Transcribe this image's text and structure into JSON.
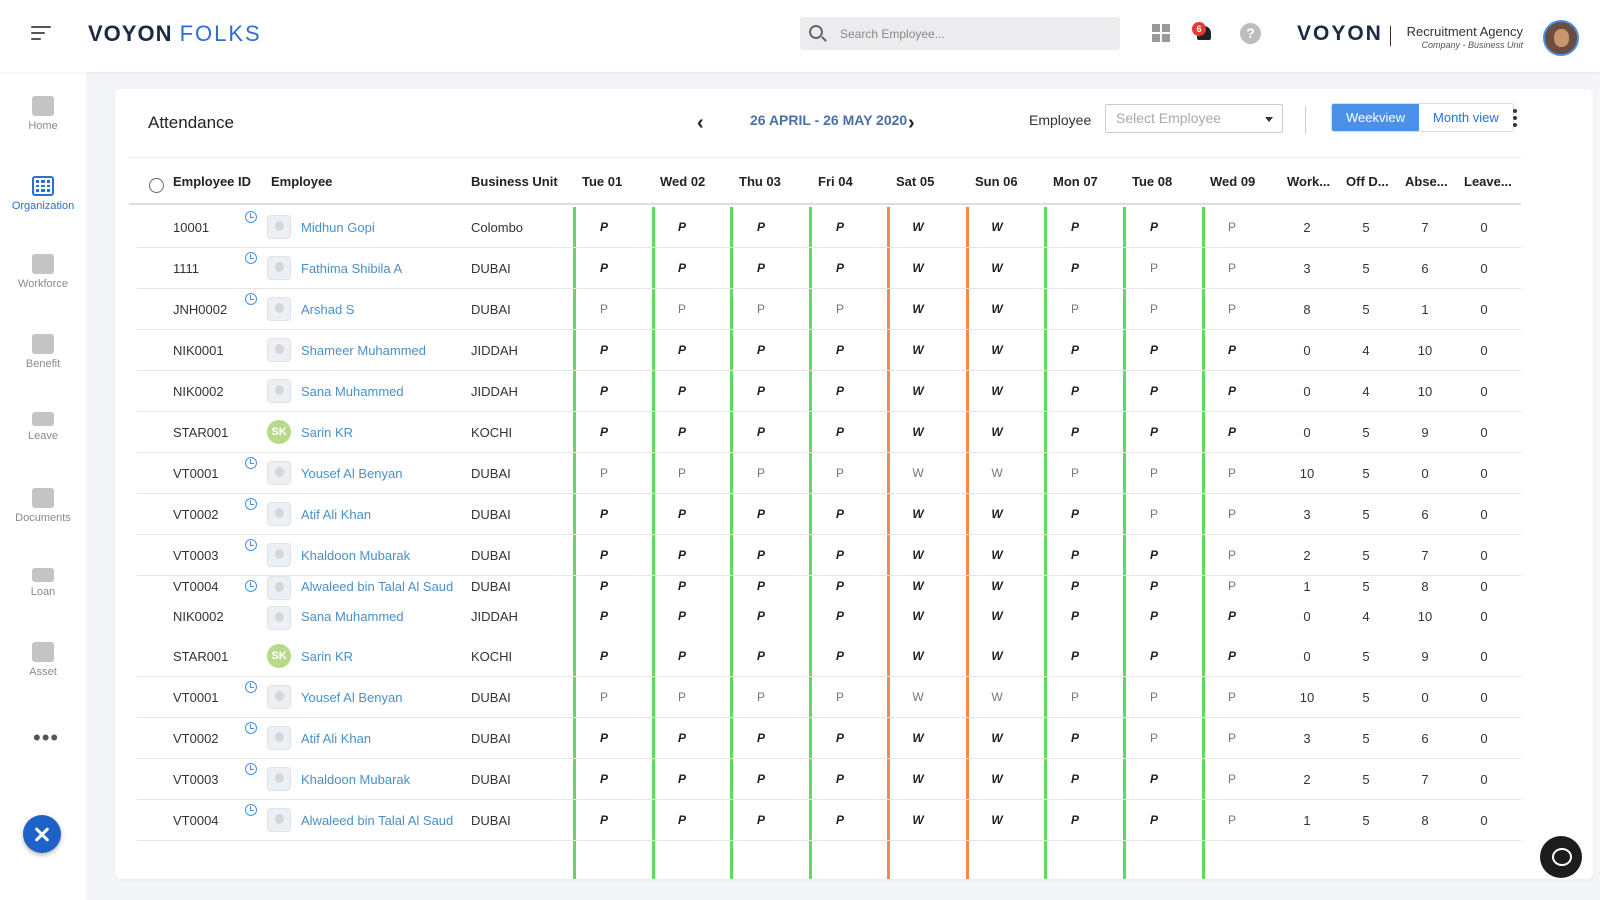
{
  "header": {
    "logo_main": "VOYON",
    "logo_sub": "FOLKS",
    "search_placeholder": "Search Employee...",
    "notification_count": "6",
    "help_glyph": "?",
    "brand": "VOYON",
    "company_name": "Recruitment Agency",
    "company_sub": "Company - Business Unit"
  },
  "sidebar": {
    "items": [
      {
        "label": "Home",
        "icon": "home-icon"
      },
      {
        "label": "Organization",
        "icon": "organization-icon"
      },
      {
        "label": "Workforce",
        "icon": "workforce-icon"
      },
      {
        "label": "Benefit",
        "icon": "benefit-icon"
      },
      {
        "label": "Leave",
        "icon": "leave-icon"
      },
      {
        "label": "Documents",
        "icon": "documents-icon"
      },
      {
        "label": "Loan",
        "icon": "loan-icon"
      },
      {
        "label": "Asset",
        "icon": "asset-icon"
      }
    ],
    "more": "•••"
  },
  "attendance": {
    "title": "Attendance",
    "date_range": "26 APRIL - 26 MAY 2020",
    "prev_glyph": "‹",
    "next_glyph": "›",
    "employee_label": "Employee",
    "employee_select_placeholder": "Select Employee",
    "view_week": "Weekview",
    "view_month": "Month view"
  },
  "table": {
    "columns": {
      "id": "Employee ID",
      "employee": "Employee",
      "unit": "Business Unit",
      "days": [
        "Tue 01",
        "Wed 02",
        "Thu 03",
        "Fri 04",
        "Sat 05",
        "Sun 06",
        "Mon 07",
        "Tue 08",
        "Wed 09"
      ],
      "stats": [
        "Work...",
        "Off D...",
        "Abse...",
        "Leave..."
      ]
    },
    "rows": [
      {
        "id": "10001",
        "name": "Midhun Gopi",
        "unit": "Colombo",
        "clock": true,
        "avatar": "photo",
        "marks": [
          "P",
          "P",
          "P",
          "P",
          "W",
          "W",
          "P",
          "P",
          "P"
        ],
        "bold": [
          1,
          1,
          1,
          1,
          1,
          1,
          1,
          1,
          0
        ],
        "stats": [
          "2",
          "5",
          "7",
          "0"
        ]
      },
      {
        "id": "1111",
        "name": "Fathima Shibila A",
        "unit": "DUBAI",
        "clock": true,
        "avatar": "photo",
        "marks": [
          "P",
          "P",
          "P",
          "P",
          "W",
          "W",
          "P",
          "P",
          "P"
        ],
        "bold": [
          1,
          1,
          1,
          1,
          1,
          1,
          1,
          0,
          0
        ],
        "stats": [
          "3",
          "5",
          "6",
          "0"
        ]
      },
      {
        "id": "JNH0002",
        "name": "Arshad S",
        "unit": "DUBAI",
        "clock": true,
        "avatar": "photo",
        "marks": [
          "P",
          "P",
          "P",
          "P",
          "W",
          "W",
          "P",
          "P",
          "P"
        ],
        "bold": [
          0,
          0,
          0,
          0,
          1,
          1,
          0,
          0,
          0
        ],
        "stats": [
          "8",
          "5",
          "1",
          "0"
        ]
      },
      {
        "id": "NIK0001",
        "name": "Shameer Muhammed",
        "unit": "JIDDAH",
        "clock": false,
        "avatar": "photo",
        "marks": [
          "P",
          "P",
          "P",
          "P",
          "W",
          "W",
          "P",
          "P",
          "P"
        ],
        "bold": [
          1,
          1,
          1,
          1,
          1,
          1,
          1,
          1,
          1
        ],
        "stats": [
          "0",
          "4",
          "10",
          "0"
        ]
      },
      {
        "id": "NIK0002",
        "name": "Sana Muhammed",
        "unit": "JIDDAH",
        "clock": false,
        "avatar": "photo",
        "marks": [
          "P",
          "P",
          "P",
          "P",
          "W",
          "W",
          "P",
          "P",
          "P"
        ],
        "bold": [
          1,
          1,
          1,
          1,
          1,
          1,
          1,
          1,
          1
        ],
        "stats": [
          "0",
          "4",
          "10",
          "0"
        ]
      },
      {
        "id": "STAR001",
        "name": "Sarin KR",
        "unit": "KOCHI",
        "clock": false,
        "avatar": "SK",
        "marks": [
          "P",
          "P",
          "P",
          "P",
          "W",
          "W",
          "P",
          "P",
          "P"
        ],
        "bold": [
          1,
          1,
          1,
          1,
          1,
          1,
          1,
          1,
          1
        ],
        "stats": [
          "0",
          "5",
          "9",
          "0"
        ]
      },
      {
        "id": "VT0001",
        "name": "Yousef Al Benyan",
        "unit": "DUBAI",
        "clock": true,
        "avatar": "photo",
        "marks": [
          "P",
          "P",
          "P",
          "P",
          "W",
          "W",
          "P",
          "P",
          "P"
        ],
        "bold": [
          0,
          0,
          0,
          0,
          0,
          0,
          0,
          0,
          0
        ],
        "stats": [
          "10",
          "5",
          "0",
          "0"
        ]
      },
      {
        "id": "VT0002",
        "name": "Atif Ali Khan",
        "unit": "DUBAI",
        "clock": true,
        "avatar": "photo",
        "marks": [
          "P",
          "P",
          "P",
          "P",
          "W",
          "W",
          "P",
          "P",
          "P"
        ],
        "bold": [
          1,
          1,
          1,
          1,
          1,
          1,
          1,
          0,
          0
        ],
        "stats": [
          "3",
          "5",
          "6",
          "0"
        ]
      },
      {
        "id": "VT0003",
        "name": "Khaldoon Mubarak",
        "unit": "DUBAI",
        "clock": true,
        "avatar": "photo",
        "marks": [
          "P",
          "P",
          "P",
          "P",
          "W",
          "W",
          "P",
          "P",
          "P"
        ],
        "bold": [
          1,
          1,
          1,
          1,
          1,
          1,
          1,
          1,
          0
        ],
        "stats": [
          "2",
          "5",
          "7",
          "0"
        ]
      },
      {
        "id": "VT0004",
        "name": "Alwaleed bin Talal Al Saud",
        "unit": "DUBAI",
        "clock": true,
        "avatar": "photo",
        "marks": [
          "P",
          "P",
          "P",
          "P",
          "W",
          "W",
          "P",
          "P",
          "P"
        ],
        "bold": [
          1,
          1,
          1,
          1,
          1,
          1,
          1,
          1,
          0
        ],
        "stats": [
          "1",
          "5",
          "8",
          "0"
        ],
        "tight": true
      },
      {
        "id": "NIK0002",
        "name": "Sana Muhammed",
        "unit": "JIDDAH",
        "clock": false,
        "avatar": "photo",
        "marks": [
          "P",
          "P",
          "P",
          "P",
          "W",
          "W",
          "P",
          "P",
          "P"
        ],
        "bold": [
          1,
          1,
          1,
          1,
          1,
          1,
          1,
          1,
          1
        ],
        "stats": [
          "0",
          "4",
          "10",
          "0"
        ],
        "tight": true
      },
      {
        "id": "STAR001",
        "name": "Sarin KR",
        "unit": "KOCHI",
        "clock": false,
        "avatar": "SK",
        "marks": [
          "P",
          "P",
          "P",
          "P",
          "W",
          "W",
          "P",
          "P",
          "P"
        ],
        "bold": [
          1,
          1,
          1,
          1,
          1,
          1,
          1,
          1,
          1
        ],
        "stats": [
          "0",
          "5",
          "9",
          "0"
        ]
      },
      {
        "id": "VT0001",
        "name": "Yousef Al Benyan",
        "unit": "DUBAI",
        "clock": true,
        "avatar": "photo",
        "marks": [
          "P",
          "P",
          "P",
          "P",
          "W",
          "W",
          "P",
          "P",
          "P"
        ],
        "bold": [
          0,
          0,
          0,
          0,
          0,
          0,
          0,
          0,
          0
        ],
        "stats": [
          "10",
          "5",
          "0",
          "0"
        ]
      },
      {
        "id": "VT0002",
        "name": "Atif Ali Khan",
        "unit": "DUBAI",
        "clock": true,
        "avatar": "photo",
        "marks": [
          "P",
          "P",
          "P",
          "P",
          "W",
          "W",
          "P",
          "P",
          "P"
        ],
        "bold": [
          1,
          1,
          1,
          1,
          1,
          1,
          1,
          0,
          0
        ],
        "stats": [
          "3",
          "5",
          "6",
          "0"
        ]
      },
      {
        "id": "VT0003",
        "name": "Khaldoon Mubarak",
        "unit": "DUBAI",
        "clock": true,
        "avatar": "photo",
        "marks": [
          "P",
          "P",
          "P",
          "P",
          "W",
          "W",
          "P",
          "P",
          "P"
        ],
        "bold": [
          1,
          1,
          1,
          1,
          1,
          1,
          1,
          1,
          0
        ],
        "stats": [
          "2",
          "5",
          "7",
          "0"
        ]
      },
      {
        "id": "VT0004",
        "name": "Alwaleed bin Talal Al Saud",
        "unit": "DUBAI",
        "clock": true,
        "avatar": "photo",
        "marks": [
          "P",
          "P",
          "P",
          "P",
          "W",
          "W",
          "P",
          "P",
          "P"
        ],
        "bold": [
          1,
          1,
          1,
          1,
          1,
          1,
          1,
          1,
          0
        ],
        "stats": [
          "1",
          "5",
          "8",
          "0"
        ]
      }
    ],
    "day_line_colors": [
      "green",
      "green",
      "green",
      "green",
      "orange",
      "orange",
      "green",
      "green",
      "green"
    ]
  },
  "colors": {
    "accent": "#2a6fd6",
    "present_line": "#5edb5e",
    "weekend_line": "#f0894a",
    "name_link": "#4a90c8"
  }
}
